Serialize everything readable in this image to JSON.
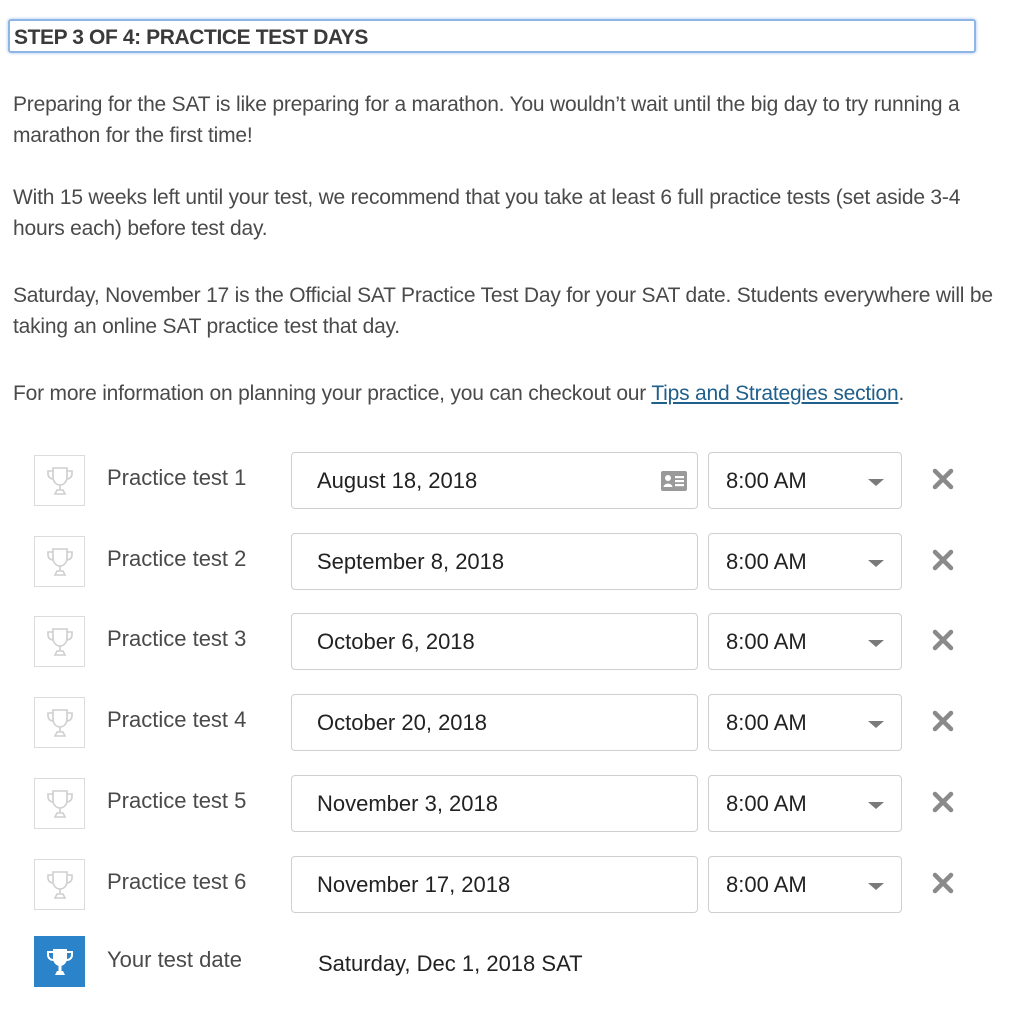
{
  "step_title": "STEP 3 OF 4: PRACTICE TEST DAYS",
  "paragraphs": {
    "p1": "Preparing for the SAT is like preparing for a marathon. You wouldn’t wait until the big day to try running a marathon for the first time!",
    "p2": "With 15 weeks left until your test, we recommend that you take at least 6 full practice tests (set aside 3-4 hours each) before test day.",
    "p3": "Saturday, November 17 is the Official SAT Practice Test Day for your SAT date. Students everywhere will be taking an online SAT practice test that day.",
    "p4_prefix": "For more information on planning your practice, you can checkout our ",
    "p4_link": "Tips and Strategies section",
    "p4_suffix": "."
  },
  "practice_tests": [
    {
      "label": "Practice test 1",
      "date": "August 18, 2018",
      "time": "8:00 AM"
    },
    {
      "label": "Practice test 2",
      "date": "September 8, 2018",
      "time": "8:00 AM"
    },
    {
      "label": "Practice test 3",
      "date": "October 6, 2018",
      "time": "8:00 AM"
    },
    {
      "label": "Practice test 4",
      "date": "October 20, 2018",
      "time": "8:00 AM"
    },
    {
      "label": "Practice test 5",
      "date": "November 3, 2018",
      "time": "8:00 AM"
    },
    {
      "label": "Practice test 6",
      "date": "November 17, 2018",
      "time": "8:00 AM"
    }
  ],
  "test_date": {
    "label": "Your test date",
    "value": "Saturday, Dec 1, 2018 SAT"
  },
  "icons": {
    "trophy": "trophy-icon",
    "calendar": "contact-card-icon",
    "dropdown": "chevron-down-icon",
    "remove": "close-icon"
  },
  "colors": {
    "accent_blue": "#2b83c9",
    "link": "#1f5f8b",
    "focus_border": "#8fb4e6"
  }
}
